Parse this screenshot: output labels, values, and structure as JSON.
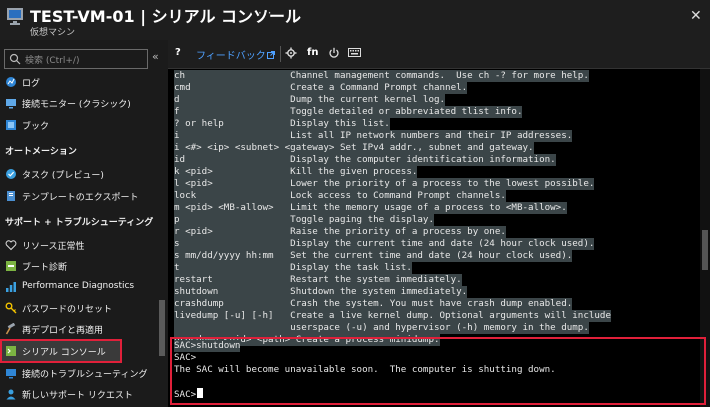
{
  "header": {
    "title": "TEST-VM-01 | シリアル コンソール",
    "subtitle": "仮想マシン",
    "more": "···",
    "close": "✕"
  },
  "sidebar": {
    "search_placeholder": "検索 (Ctrl+/)",
    "collapse": "«",
    "items": [
      {
        "label": "ログ",
        "icon": "log-icon"
      },
      {
        "label": "接続モニター (クラシック)",
        "icon": "connection-monitor-icon"
      },
      {
        "label": "ブック",
        "icon": "workbook-icon"
      },
      {
        "label": "オートメーション",
        "section": true
      },
      {
        "label": "タスク (プレビュー)",
        "icon": "task-icon"
      },
      {
        "label": "テンプレートのエクスポート",
        "icon": "export-template-icon"
      },
      {
        "label": "サポート + トラブルシューティング",
        "section": true
      },
      {
        "label": "リソース正常性",
        "icon": "heart-icon"
      },
      {
        "label": "ブート診断",
        "icon": "boot-diagnostics-icon"
      },
      {
        "label": "Performance Diagnostics",
        "icon": "performance-icon"
      },
      {
        "label": "パスワードのリセット",
        "icon": "key-icon"
      },
      {
        "label": "再デプロイと再適用",
        "icon": "hammer-icon"
      },
      {
        "label": "シリアル コンソール",
        "icon": "serial-console-icon",
        "selected": true
      },
      {
        "label": "接続のトラブルシューティング",
        "icon": "troubleshoot-icon"
      },
      {
        "label": "新しいサポート リクエスト",
        "icon": "support-icon"
      }
    ]
  },
  "toolbar": {
    "help": "?",
    "feedback": "フィードバック",
    "fn": "fn"
  },
  "terminal": {
    "lines": [
      "ch                   Channel management commands.  Use ch -? for more help.",
      "cmd                  Create a Command Prompt channel.",
      "d                    Dump the current kernel log.",
      "f                    Toggle detailed or abbreviated tlist info.",
      "? or help            Display this list.",
      "i                    List all IP network numbers and their IP addresses.",
      "i <#> <ip> <subnet> <gateway> Set IPv4 addr., subnet and gateway.",
      "id                   Display the computer identification information.",
      "k <pid>              Kill the given process.",
      "l <pid>              Lower the priority of a process to the lowest possible.",
      "lock                 Lock access to Command Prompt channels.",
      "m <pid> <MB-allow>   Limit the memory usage of a process to <MB-allow>.",
      "p                    Toggle paging the display.",
      "r <pid>              Raise the priority of a process by one.",
      "s                    Display the current time and date (24 hour clock used).",
      "s mm/dd/yyyy hh:mm   Set the current time and date (24 hour clock used).",
      "t                    Display the task list.",
      "restart              Restart the system immediately.",
      "shutdown             Shutdown the system immediately.",
      "crashdump            Crash the system. You must have crash dump enabled.",
      "livedump [-u] [-h]   Create a live kernel dump. Optional arguments will include",
      "                     userspace (-u) and hypervisor (-h) memory in the dump.",
      "procdump <pid> <path> Create a process minidump."
    ],
    "command_lines": [
      "SAC>shutdown",
      "SAC>",
      "The SAC will become unavailable soon.  The computer is shutting down.",
      "",
      "SAC>"
    ]
  },
  "colors": {
    "accent": "#4ea0ff",
    "highlight_box": "#e0203a",
    "line_highlight": "#3b4548"
  }
}
